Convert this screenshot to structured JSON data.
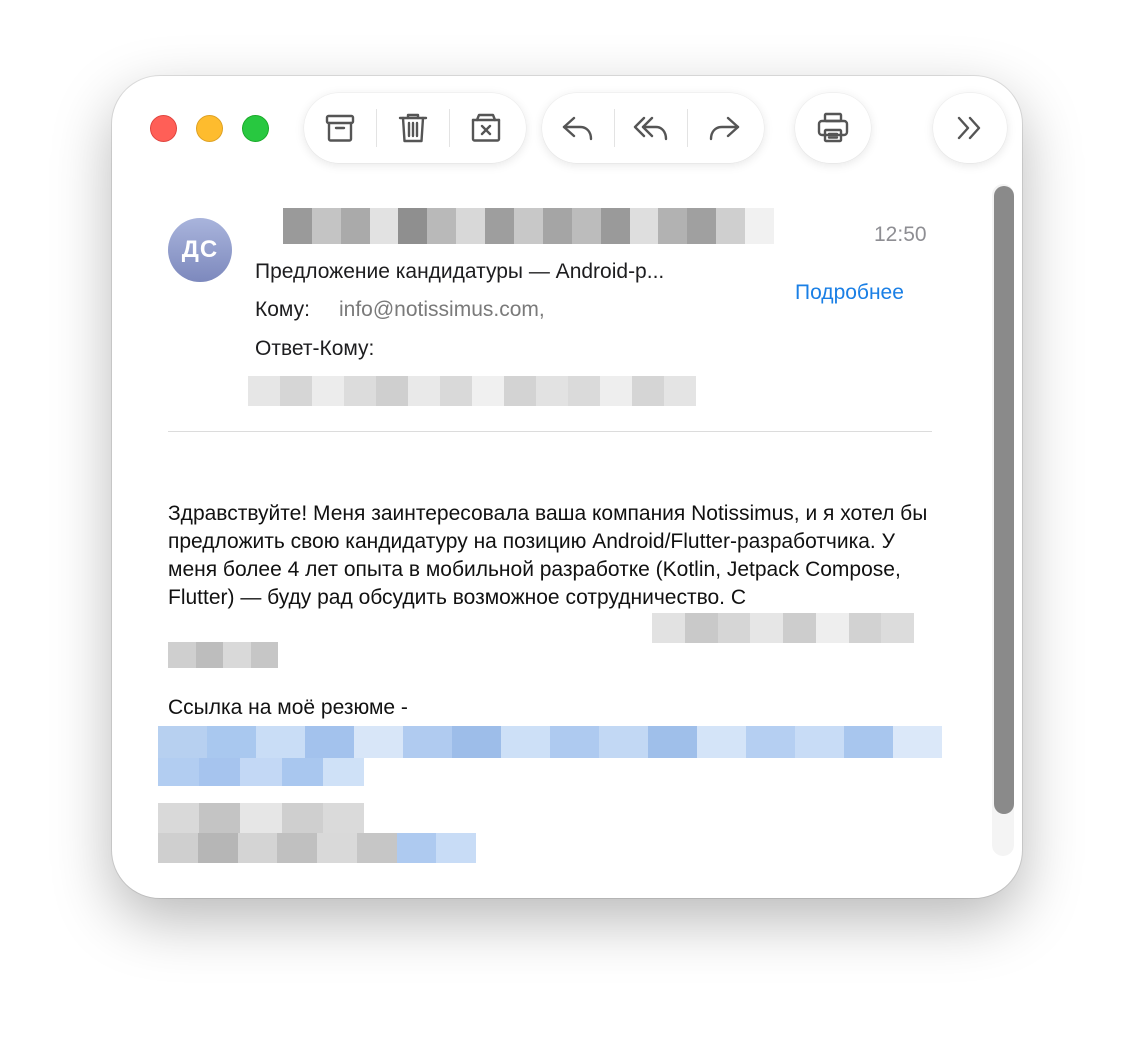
{
  "toolbar": {
    "archive_icon": "archive-box-icon",
    "delete_icon": "trash-icon",
    "junk_icon": "junk-box-icon",
    "reply_icon": "reply-icon",
    "reply_all_icon": "reply-all-icon",
    "forward_icon": "forward-icon",
    "print_icon": "printer-icon",
    "more_icon": "chevron-double-right-icon"
  },
  "message": {
    "avatar_initials": "ДС",
    "time": "12:50",
    "subject": "Предложение кандидатуры — Android-р...",
    "details_link": "Подробнее",
    "to_label": "Кому:",
    "to_value": "info@notissimus.com,",
    "reply_to_label": "Ответ-Кому:",
    "body": "Здравствуйте! Меня заинтересовала ваша компания Notissimus, и я хотел бы предложить свою кандидатуру на позицию Android/Flutter-разработчика. У меня более 4 лет опыта в мобильной разработке (Kotlin, Jetpack Compose, Flutter) — буду рад обсудить возможное сотрудничество. С",
    "resume_label": "Ссылка на моё резюме -"
  },
  "colors": {
    "link": "#1a7fe5",
    "close": "#ff5f57",
    "minimize": "#febc2e",
    "zoom": "#28c840"
  }
}
